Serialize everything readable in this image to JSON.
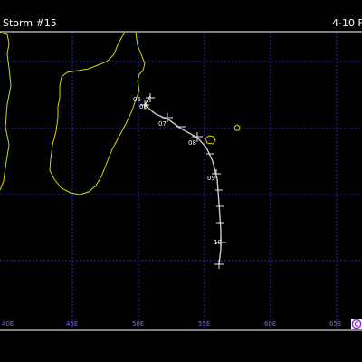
{
  "header": {
    "title": "Storm #15",
    "date_range": "4-10 F"
  },
  "colors": {
    "background": "#000000",
    "grid": "#3a3aff",
    "coastline": "#d8d800",
    "track": "#c8c8c8",
    "text": "#ffffff",
    "axis_label": "#6b6bff",
    "logo": "#8a2be2"
  },
  "longitude_labels": [
    "40E",
    "45E",
    "50E",
    "55E",
    "60E",
    "65E"
  ],
  "track_labels": [
    {
      "text": "05"
    },
    {
      "text": "06"
    },
    {
      "text": "07"
    },
    {
      "text": "08"
    },
    {
      "text": "09"
    },
    {
      "text": "10"
    }
  ],
  "logo": {
    "icon": "copyright-logo-icon"
  }
}
